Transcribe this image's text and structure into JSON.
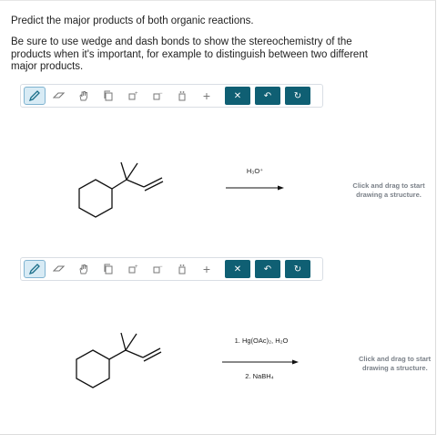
{
  "instructions": {
    "line1": "Predict the major products of both organic reactions.",
    "line2": "Be sure to use wedge and dash bonds to show the stereochemistry of the products when it's important, for example to distinguish between two different major products."
  },
  "reaction1": {
    "reagent": "H₃O⁺",
    "placeholder_line1": "Click and drag to start",
    "placeholder_line2": "drawing a structure."
  },
  "reaction2": {
    "reagent_step1": "1. Hg(OAc)₂, H₂O",
    "reagent_step2": "2. NaBH₄",
    "placeholder_line1": "Click and drag to start",
    "placeholder_line2": "drawing a structure."
  },
  "toolbar": {
    "tools": [
      "pencil-icon",
      "eraser-icon",
      "hand-icon",
      "copy-icon",
      "positive-charge-icon",
      "negative-charge-icon",
      "lone-pair-icon",
      "add-icon"
    ],
    "actions": {
      "clear_symbol": "✕",
      "undo_symbol": "↶",
      "reset_symbol": "↻"
    },
    "plus_symbol": "+"
  },
  "colors": {
    "accent": "#0f5f73",
    "active_tool": "#d8ebf5"
  }
}
